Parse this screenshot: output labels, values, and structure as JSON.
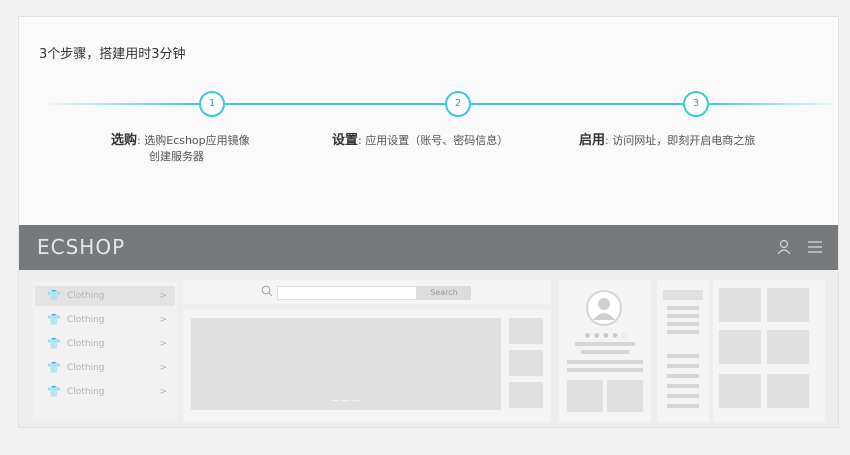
{
  "heading": "3个步骤，搭建用时3分钟",
  "steps": [
    {
      "number": "1",
      "title": "选购",
      "desc_line1": ": 选购Ecshop应用镜像",
      "desc_line2": "创建服务器"
    },
    {
      "number": "2",
      "title": "设置",
      "desc_line1": ": 应用设置（账号、密码信息）"
    },
    {
      "number": "3",
      "title": "启用",
      "desc_line1": ": 访问网址，即刻开启电商之旅"
    }
  ],
  "mock": {
    "logo": "ECSHOP",
    "icons": {
      "user": "user-icon",
      "menu": "hamburger-menu-icon"
    },
    "sidebar": [
      {
        "label": "Clothing",
        "arrow": ">"
      },
      {
        "label": "Clothing",
        "arrow": ">"
      },
      {
        "label": "Clothing",
        "arrow": ">"
      },
      {
        "label": "Clothing",
        "arrow": ">"
      },
      {
        "label": "Clothing",
        "arrow": ">"
      }
    ],
    "search_button": "Search",
    "dots": "— — —"
  },
  "colors": {
    "accent": "#3ec7db",
    "header": "#777a7d"
  }
}
